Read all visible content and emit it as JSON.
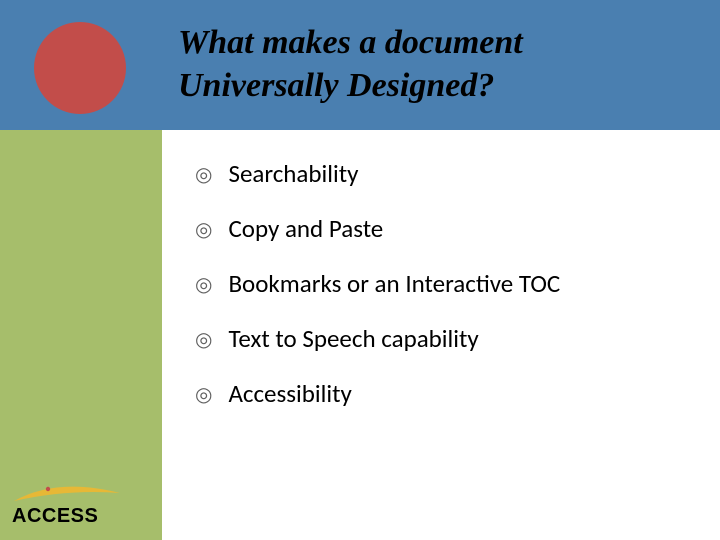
{
  "title_line1": "What makes a document",
  "title_line2": "Universally Designed?",
  "bullets": [
    "Searchability",
    "Copy and Paste",
    "Bookmarks or an Interactive TOC",
    "Text to Speech capability",
    "Accessibility"
  ],
  "logo_text": "ACCESS",
  "bullet_glyph": "◎"
}
